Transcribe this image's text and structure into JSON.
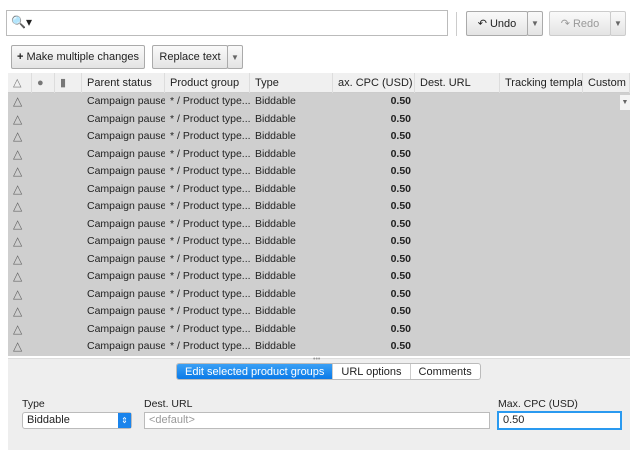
{
  "toolbar": {
    "search_icon": "search-icon",
    "undo": "Undo",
    "redo": "Redo",
    "make_multiple": "Make multiple changes",
    "replace_text": "Replace text"
  },
  "table": {
    "headers": [
      "",
      "",
      "",
      "Parent status",
      "Product group",
      "Type",
      "ax. CPC (USD)",
      "Dest. URL",
      "Tracking templat",
      "Custom p"
    ],
    "rows": [
      [
        "Campaign paused",
        "* / Product type...",
        "Biddable",
        "0.50"
      ],
      [
        "Campaign paused",
        "* / Product type...",
        "Biddable",
        "0.50"
      ],
      [
        "Campaign paused",
        "* / Product type...",
        "Biddable",
        "0.50"
      ],
      [
        "Campaign paused",
        "* / Product type...",
        "Biddable",
        "0.50"
      ],
      [
        "Campaign paused",
        "* / Product type...",
        "Biddable",
        "0.50"
      ],
      [
        "Campaign paused",
        "* / Product type...",
        "Biddable",
        "0.50"
      ],
      [
        "Campaign paused",
        "* / Product type...",
        "Biddable",
        "0.50"
      ],
      [
        "Campaign paused",
        "* / Product type...",
        "Biddable",
        "0.50"
      ],
      [
        "Campaign paused",
        "* / Product type...",
        "Biddable",
        "0.50"
      ],
      [
        "Campaign paused",
        "* / Product type...",
        "Biddable",
        "0.50"
      ],
      [
        "Campaign paused",
        "* / Product type...",
        "Biddable",
        "0.50"
      ],
      [
        "Campaign paused",
        "* / Product type...",
        "Biddable",
        "0.50"
      ],
      [
        "Campaign paused",
        "* / Product type...",
        "Biddable",
        "0.50"
      ],
      [
        "Campaign paused",
        "* / Product type...",
        "Biddable",
        "0.50"
      ],
      [
        "Campaign paused",
        "* / Product type...",
        "Biddable",
        "0.50"
      ]
    ]
  },
  "editor": {
    "tabs": [
      "Edit selected product groups",
      "URL options",
      "Comments"
    ],
    "type_label": "Type",
    "type_value": "Biddable",
    "dest_label": "Dest. URL",
    "dest_placeholder": "<default>",
    "cpc_label": "Max. CPC (USD)",
    "cpc_value": "0.50"
  },
  "colors": {
    "accent": "#0a7ae8",
    "row_bg": "#cfcfcf"
  }
}
